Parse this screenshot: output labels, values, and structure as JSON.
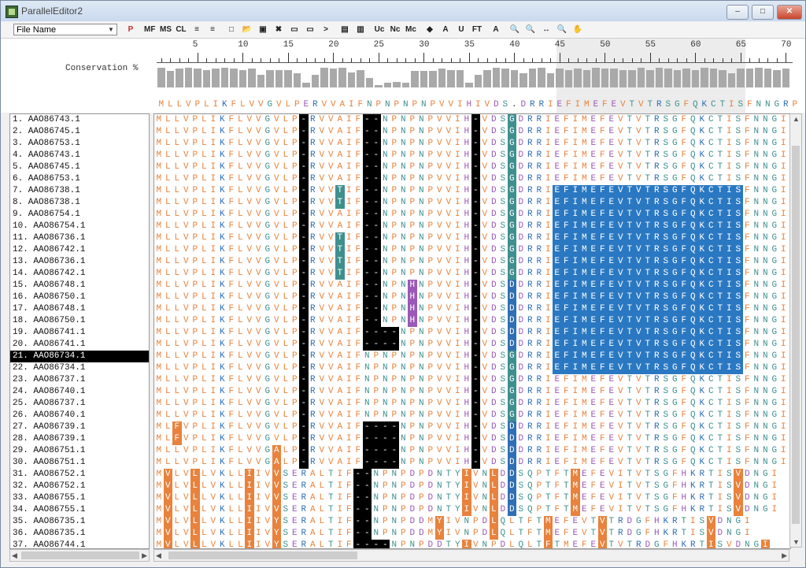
{
  "window": {
    "title": "ParallelEditor2"
  },
  "toolbar": {
    "sort_select_value": "File Name",
    "buttons": [
      "P",
      "MF",
      "MS",
      "CL",
      "≡",
      "≡",
      "□",
      "📂",
      "▣",
      "✖",
      "▭",
      "▭",
      ">",
      "▤",
      "▥",
      "Uc",
      "Nc",
      "Mc",
      "◆",
      "A",
      "U",
      "FT",
      "A",
      "🔍",
      "🔍",
      "↔",
      "🔍",
      "✋"
    ]
  },
  "header": {
    "conservation_label": "Conservation %",
    "ruler_numbers": [
      "5",
      "10",
      "15",
      "20",
      "25",
      "30",
      "35",
      "40",
      "45",
      "50",
      "55",
      "60",
      "65",
      "70"
    ],
    "consensus": "MLLVPLIKFLVVGVLPERVVAIFNPNPNPNPVVIHIVDS.DRRIEFIMEFEVTVTRSGFQKCTISFNNGRP",
    "conservation": [
      85,
      70,
      80,
      85,
      80,
      75,
      80,
      85,
      80,
      75,
      80,
      55,
      75,
      75,
      75,
      60,
      20,
      55,
      85,
      80,
      85,
      65,
      75,
      40,
      10,
      20,
      25,
      20,
      70,
      70,
      70,
      80,
      75,
      75,
      20,
      55,
      75,
      85,
      80,
      75,
      60,
      80,
      85,
      60,
      80,
      75,
      80,
      75,
      85,
      80,
      80,
      75,
      75,
      85,
      75,
      85,
      80,
      75,
      80,
      75,
      85,
      80,
      75,
      60,
      80,
      80,
      85,
      80,
      75,
      80
    ]
  },
  "names": [
    "1. AAO86743.1",
    "2. AAO86745.1",
    "3. AAO86753.1",
    "4. AAO86743.1",
    "5. AAO86745.1",
    "6. AAO86753.1",
    "7. AAO86738.1",
    "8. AAO86738.1",
    "9. AAO86754.1",
    "10. AAO86754.1",
    "11. AAO86736.1",
    "12. AAO86742.1",
    "13. AAO86736.1",
    "14. AAO86742.1",
    "15. AAO86748.1",
    "16. AAO86750.1",
    "17. AAO86748.1",
    "18. AAO86750.1",
    "19. AAO86741.1",
    "20. AAO86741.1",
    "21. AAO86734.1",
    "22. AAO86734.1",
    "23. AAO86737.1",
    "24. AAO86740.1",
    "25. AAO86737.1",
    "26. AAO86740.1",
    "27. AAO86739.1",
    "28. AAO86739.1",
    "29. AAO86751.1",
    "30. AAO86751.1",
    "31. AAO86752.1",
    "32. AAO86752.1",
    "33. AAO86755.1",
    "34. AAO86755.1",
    "35. AAO86735.1",
    "36. AAO86735.1",
    "37. AAO86744.1"
  ],
  "selected_index": 20,
  "sequences": [
    "MLLVPLIKFLVVGVLP-RVVAIF--NPNPNPVVIH-VDSGDRRIEFIMEFEVTVTRSGFQKCTISFNNGI",
    "MLLVPLIKFLVVGVLP-RVVAIF--NPNPNPVVIH-VDSGDRRIEFIMEFEVTVTRSGFQKCTISFNNGI",
    "MLLVPLIKFLVVGVLP-RVVAIF--NPNPNPVVIH-VDSGDRRIEFIMEFEVTVTRSGFQKCTISFNNGI",
    "MLLVPLIKFLVVGVLP-RVVAIF--NPNPNPVVIH-VDSGDRRIEFIMEFEVTVTRSGFQKCTISFNNGI",
    "MLLVPLIKFLVVGVLP-RVVAIF--NPNPNPVVIH-VDSGDRRIEFIMEFEVTVTRSGFQKCTISFNNGI",
    "MLLVPLIKFLVVGVLP-RVVAIF--NPNPNPVVIH-VDSGDRRIEFIMEFEVTVTRSGFQKCTISFNNGI",
    "MLLVPLIKFLVVGVLP-RVVTIF--NPNPNPVVIH-VDSGDRRIEFIMEFEVTVTRSGFQKCTISFNNGI",
    "MLLVPLIKFLVVGVLP-RVVTIF--NPNPNPVVIH-VDSGDRRIEFIMEFEVTVTRSGFQKCTISFNNGI",
    "MLLVPLIKFLVVGVLP-RVVAIF--NPNPNPVVIH-VDSGDRRIEFIMEFEVTVTRSGFQKCTISFNNGI",
    "MLLVPLIKFLVVGVLP-RVVAIF--NPNPNPVVIH-VDSGDRRIEFIMEFEVTVTRSGFQKCTISFNNGI",
    "MLLVPLIKFLVVGVLP-RVVTIF--NPNPNPVVIH-VDSGDRRIEFIMEFEVTVTRSGFQKCTISFNNGI",
    "MLLVPLIKFLVVGVLP-RVVTIF--NPNPNPVVIH-VDSGDRRIEFIMEFEVTVTRSGFQKCTISFNNGI",
    "MLLVPLIKFLVVGVLP-RVVTIF--NPNPNPVVIH-VDSGDRRIEFIMEFEVTVTRSGFQKCTISFNNGI",
    "MLLVPLIKFLVVGVLP-RVVTIF--NPNPNPVVIH-VDSGDRRIEFIMEFEVTVTRSGFQKCTISFNNGI",
    "MLLVPLIKFLVVGVLP-RVVAIF--NPNHNPVVIH-VDSDDRRIEFIMEFEVTVTRSGFQKCTISFNNGI",
    "MLLVPLIKFLVVGVLP-RVVAIF--NPNHNPVVIH-VDSDDRRIEFIMEFEVTVTRSGFQKCTISFNNGI",
    "MLLVPLIKFLVVGVLP-RVVAIF--NPNHNPVVIH-VDSDDRRIEFIMEFEVTVTRSGFQKCTISFNNGI",
    "MLLVPLIKFLVVGVLP-RVVAIF--NPNHNPVVIH-VDSDDRRIEFIMEFEVTVTRSGFQKCTISFNNGI",
    "MLLVPLIKFLVVGVLP-RVVAIF----NPNPVVIH-VDSDDRRIEFIMEFEVTVTRSGFQKCTISFNNGI",
    "MLLVPLIKFLVVGVLP-RVVAIF----NPNPVVIH-VDSDDRRIEFIMEFEVTVTRSGFQKCTISFNNGI",
    "MLLVPLIKFLVVGVLP-RVVAIFNPNPNPNPVVIH-VDSGDRRIEFIMEFEVTVTRSGFQKCTISFNNGI",
    "MLLVPLIKFLVVGVLP-RVVAIFNPNPNPNPVVIH-VDSGDRRIEFIMEFEVTVTRSGFQKCTISFNNGI",
    "MLLVPLIKFLVVGVLP-RVVAIFNPNPNPNPVVIH-VDSGDRRIEFIMEFEVTVTRSGFQKCTISFNNGI",
    "MLLVPLIKFLVVGVLP-RVVAIFNPNPNPNPVVIH-VDSGDRRIEFIMEFEVTVTRSGFQKCTISFNNGI",
    "MLLVPLIKFLVVGVLP-RVVAIFNPNPNPNPVVIH-VDSGDRRIEFIMEFEVTVTRSGFQKCTISFNNGI",
    "MLLVPLIKFLVVGVLP-RVVAIFNPNPNPNPVVIH-VDSGDRRIEFIMEFEVTVTRSGFQKCTISFNNGI",
    "MLFVPLIKFLVVGVLP-RVVAIF----NPNPVVIH-VDSDDRRIEFIMEFEVTVTRSGFQKCTISFNNGI",
    "MLFVPLIKFLVVGVLP-RVVAIF----NPNPVVIH-VDSDDRRIEFIMEFEVTVTRSGFQKCTISFNNGI",
    "MLLVPLIKFLVVGALP-RVVAIF----NPNPVVIH-VDSDDRRIEFIMEFEVTVTRSGFQKCTISFNNGI",
    "MLLVPLIKFLVVGALP-RVVAIF----NPNPVVIH-VDSDDRRIEFIMEFEVTVTRSGFQKCTISFNNGI",
    "MVLVLLVKLLIIVVSERALTIF--NPNPDPDNTYIVNLDDSQPTFTMEFEVITVTSGFHKRTISVDNGI",
    "MVLVLLVKLLIIVVSERALTIF--NPNPDPDNTYIVNLDDSQPTFTMEFEVITVTSGFHKRTISVDNGI",
    "MVLVLLVKLLIIVVSERALTIF--NPNPDPDNTYIVNLDDSQPTFTMEFEVITVTSGFHKRTISVDNGI",
    "MVLVLLVKLLIIVVSERALTIF--NPNPDPDNTYIVNLDDSQPTFTMEFEVITVTSGFHKRTISVDNGI",
    "MVLVLLVKLLIIVYSERALTIF--NPNPDDMYIVNPDLQLTFTMEFEVTVTRDGFHKRTISVDNGI",
    "MVLVLLVKLLIIVYSERALTIF--NPNPDDMYIVNPDLQLTFTMEFEVTVTRDGFHKRTISVDNGI",
    "MVLVLLVKLLIIVYSERALTIF----NPNPDDTYIVNPDLQLTFTMEFEVTVTRDGFHKRTISVDNGI"
  ],
  "scroll": {
    "vertical_fraction": 0.12,
    "horizontal_fraction": 0.3
  },
  "colors": {
    "orange": "#e8823c",
    "blue": "#2f6fb5",
    "purple": "#9b59b6",
    "teal": "#3f8f8f",
    "gap": "#000000",
    "selection": "#000000",
    "highlight": "#2a78c2",
    "bar": "#a9a9a9"
  }
}
